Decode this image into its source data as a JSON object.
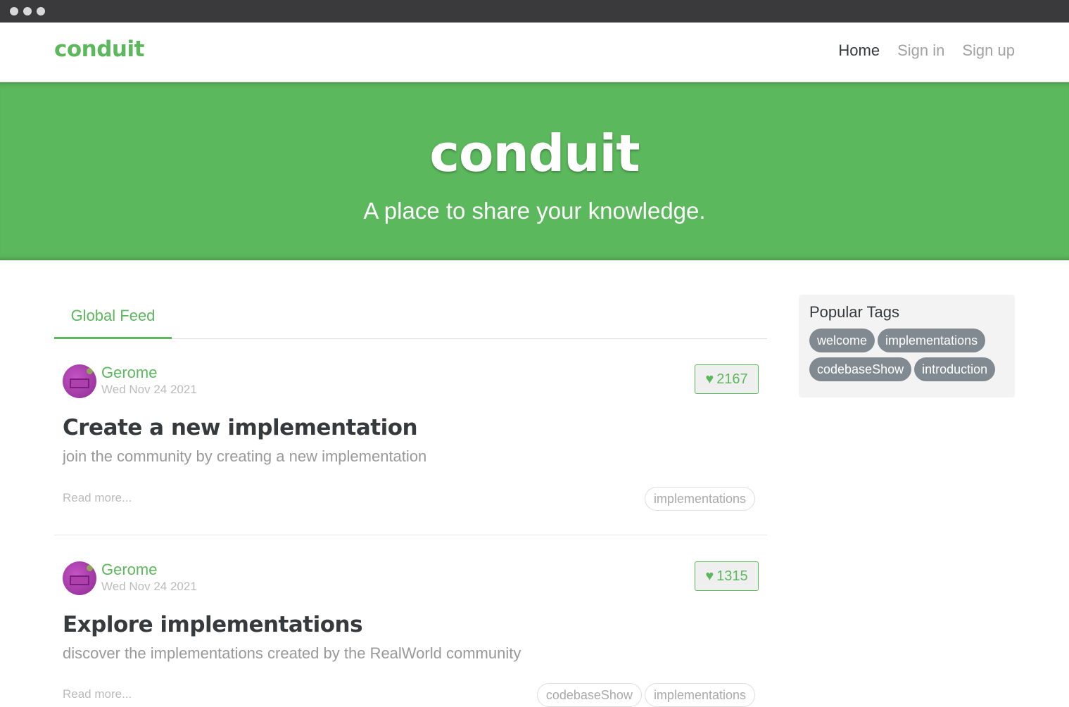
{
  "nav": {
    "brand": "conduit",
    "links": [
      "Home",
      "Sign in",
      "Sign up"
    ]
  },
  "banner": {
    "title": "conduit",
    "subtitle": "A place to share your knowledge."
  },
  "feed": {
    "tab": "Global Feed",
    "articles": [
      {
        "author": "Gerome",
        "date": "Wed Nov 24 2021",
        "likes": "2167",
        "title": "Create a new implementation",
        "description": "join the community by creating a new implementation",
        "read_more": "Read more...",
        "tags": [
          "implementations"
        ]
      },
      {
        "author": "Gerome",
        "date": "Wed Nov 24 2021",
        "likes": "1315",
        "title": "Explore implementations",
        "description": "discover the implementations created by the RealWorld community",
        "read_more": "Read more...",
        "tags": [
          "codebaseShow",
          "implementations"
        ]
      }
    ]
  },
  "sidebar": {
    "heading": "Popular Tags",
    "tags": [
      "welcome",
      "implementations",
      "codebaseShow",
      "introduction"
    ]
  },
  "colors": {
    "brand": "#5cb85c",
    "tag_pill": "#818a91"
  }
}
